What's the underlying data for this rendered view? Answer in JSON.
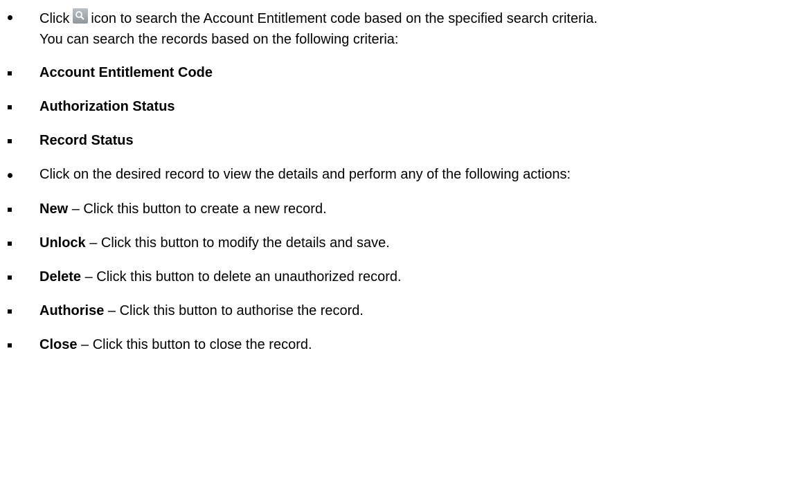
{
  "intro": {
    "line1_before_icon": "Click",
    "line1_after_icon": "icon to search the Account Entitlement code based on the specified search criteria.",
    "line2": "You can search the records based on the following criteria:",
    "icon": "search-icon"
  },
  "criteria": [
    "Account Entitlement Code",
    "Authorization Status",
    "Record Status"
  ],
  "actions_intro": "Click on the desired record to view the details and perform any of the following actions:",
  "actions": [
    {
      "name": "New",
      "desc": "– Click this button to create a new record."
    },
    {
      "name": "Unlock",
      "desc": "– Click this button to modify the details and save."
    },
    {
      "name": "Delete",
      "desc": "– Click this button to delete an unauthorized record."
    },
    {
      "name": "Authorise",
      "desc": "– Click this button to authorise the record."
    },
    {
      "name": "Close",
      "desc": "– Click this button to close the record."
    }
  ]
}
